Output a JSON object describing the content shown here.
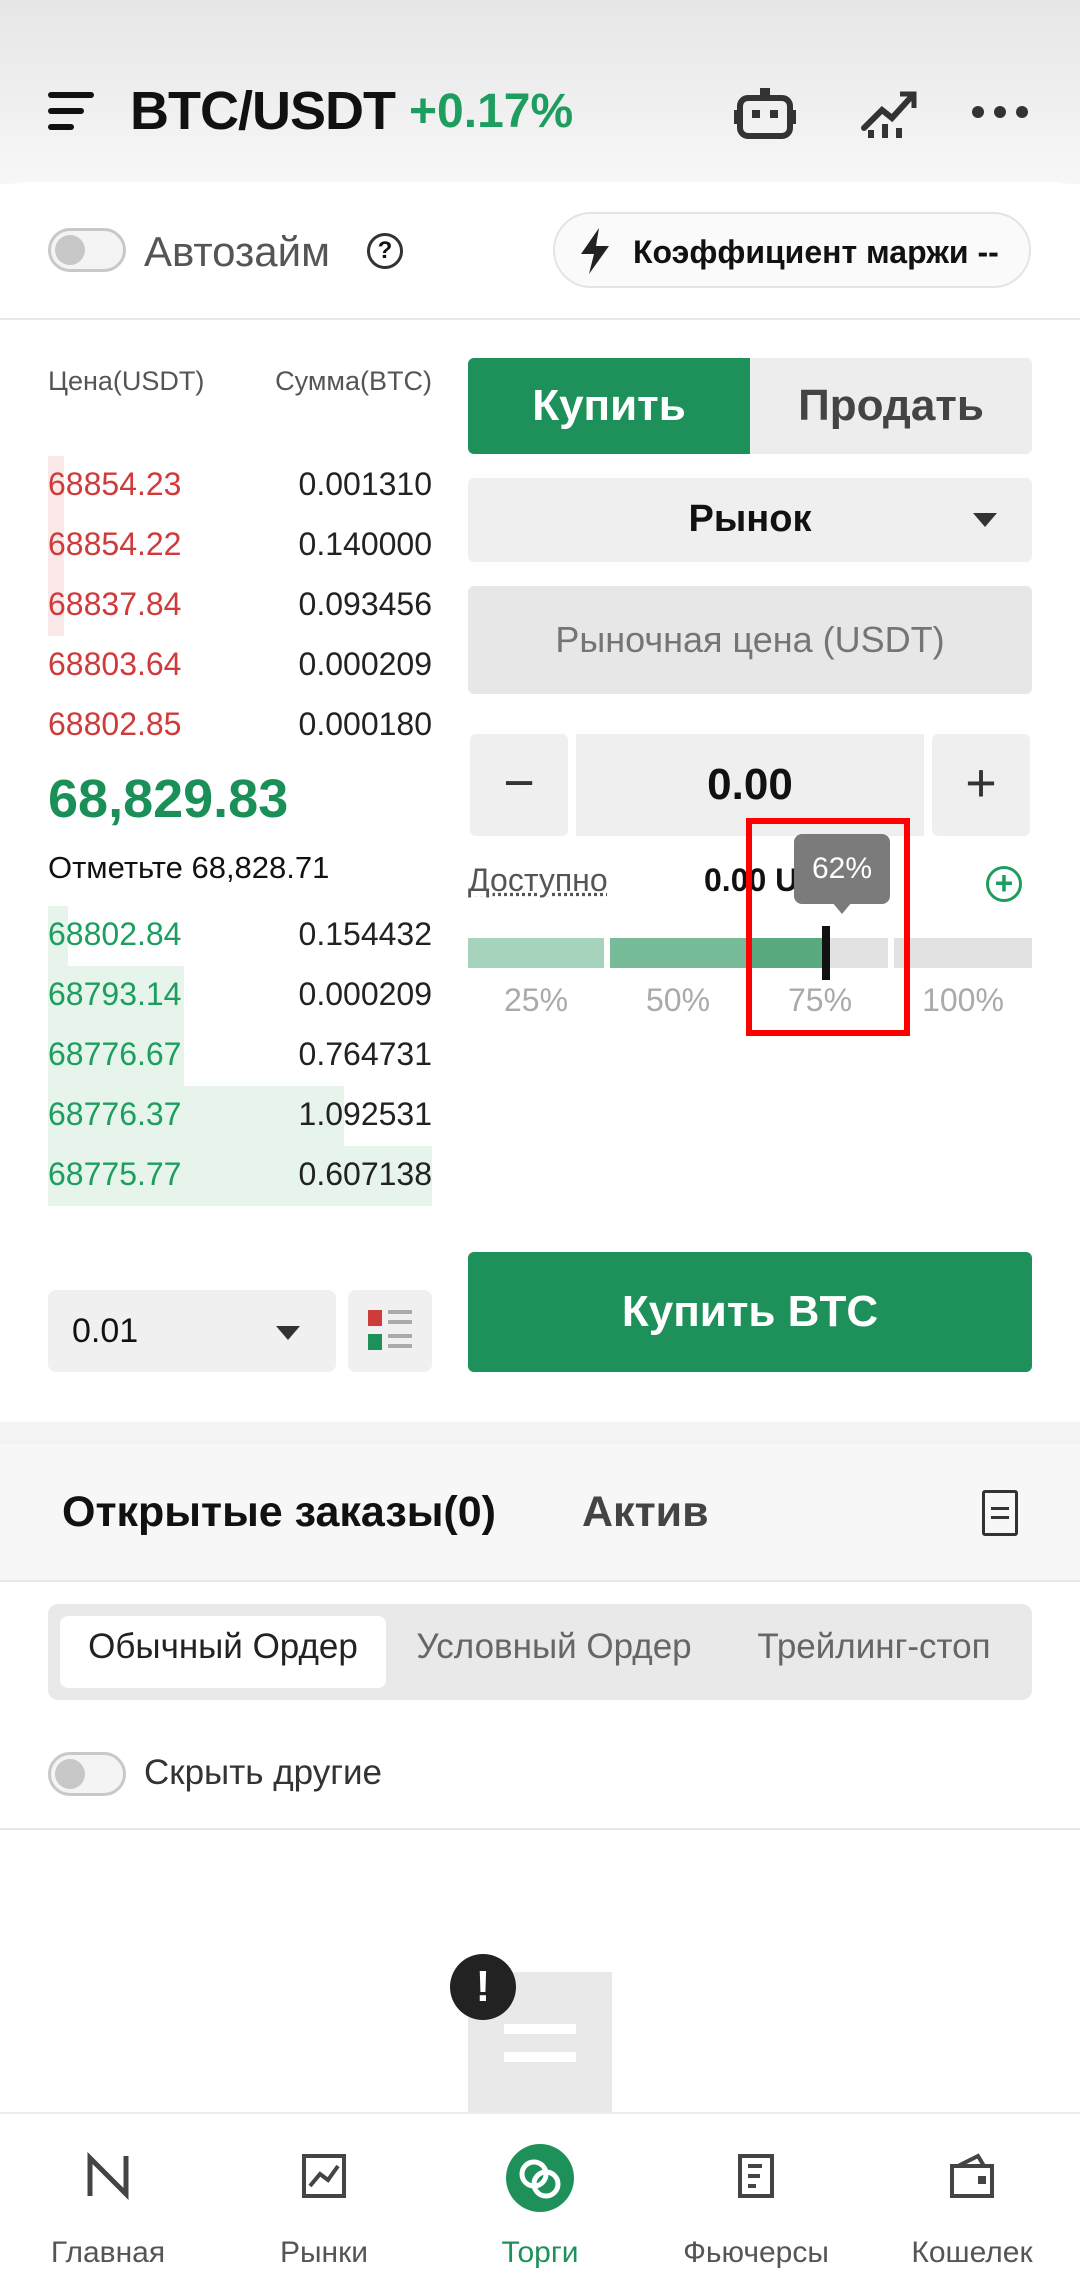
{
  "header": {
    "pair": "BTC/USDT",
    "change": "+0.17%",
    "icons": [
      "menu-icon",
      "robot-icon",
      "chart-trend-icon",
      "more-icon"
    ]
  },
  "autoloan": {
    "label": "Автозайм",
    "enabled": false
  },
  "margin_ratio": {
    "label": "Коэффициент маржи --"
  },
  "orderbook": {
    "price_header": "Цена(USDT)",
    "amount_header": "Сумма(BTC)",
    "asks": [
      {
        "price": "68854.23",
        "amount": "0.001310"
      },
      {
        "price": "68854.22",
        "amount": "0.140000"
      },
      {
        "price": "68837.84",
        "amount": "0.093456"
      },
      {
        "price": "68803.64",
        "amount": "0.000209"
      },
      {
        "price": "68802.85",
        "amount": "0.000180"
      }
    ],
    "last_price": "68,829.83",
    "mark_price": "Отметьте 68,828.71",
    "bids": [
      {
        "price": "68802.84",
        "amount": "0.154432"
      },
      {
        "price": "68793.14",
        "amount": "0.000209"
      },
      {
        "price": "68776.67",
        "amount": "0.764731"
      },
      {
        "price": "68776.37",
        "amount": "1.092531"
      },
      {
        "price": "68775.77",
        "amount": "0.607138"
      }
    ],
    "depth": "0.01"
  },
  "trade": {
    "buy_tab": "Купить",
    "sell_tab": "Продать",
    "order_type": "Рынок",
    "price_placeholder": "Рыночная цена (USDT)",
    "quantity": "0.00",
    "minus": "−",
    "plus": "+",
    "available_label": "Доступно",
    "available_value": "0.00 USDT",
    "slider_percent": 62,
    "slider_tooltip": "62%",
    "slider_labels": [
      "25%",
      "50%",
      "75%",
      "100%"
    ],
    "submit": "Купить BTC"
  },
  "orders": {
    "open_tab": "Открытые заказы(0)",
    "assets_tab": "Актив",
    "subtabs": [
      "Обычный Ордер",
      "Условный Ордер",
      "Трейлинг-стоп"
    ],
    "hide_others": "Скрыть другие"
  },
  "nav": [
    {
      "label": "Главная",
      "icon": "home-logo-icon"
    },
    {
      "label": "Рынки",
      "icon": "markets-chart-icon"
    },
    {
      "label": "Торги",
      "icon": "trade-icon",
      "active": true
    },
    {
      "label": "Фьючерсы",
      "icon": "futures-icon"
    },
    {
      "label": "Кошелек",
      "icon": "wallet-icon"
    }
  ],
  "colors": {
    "accent_green": "#1e915a",
    "ask_red": "#cf3b3b",
    "highlight_red": "#ff0000"
  }
}
